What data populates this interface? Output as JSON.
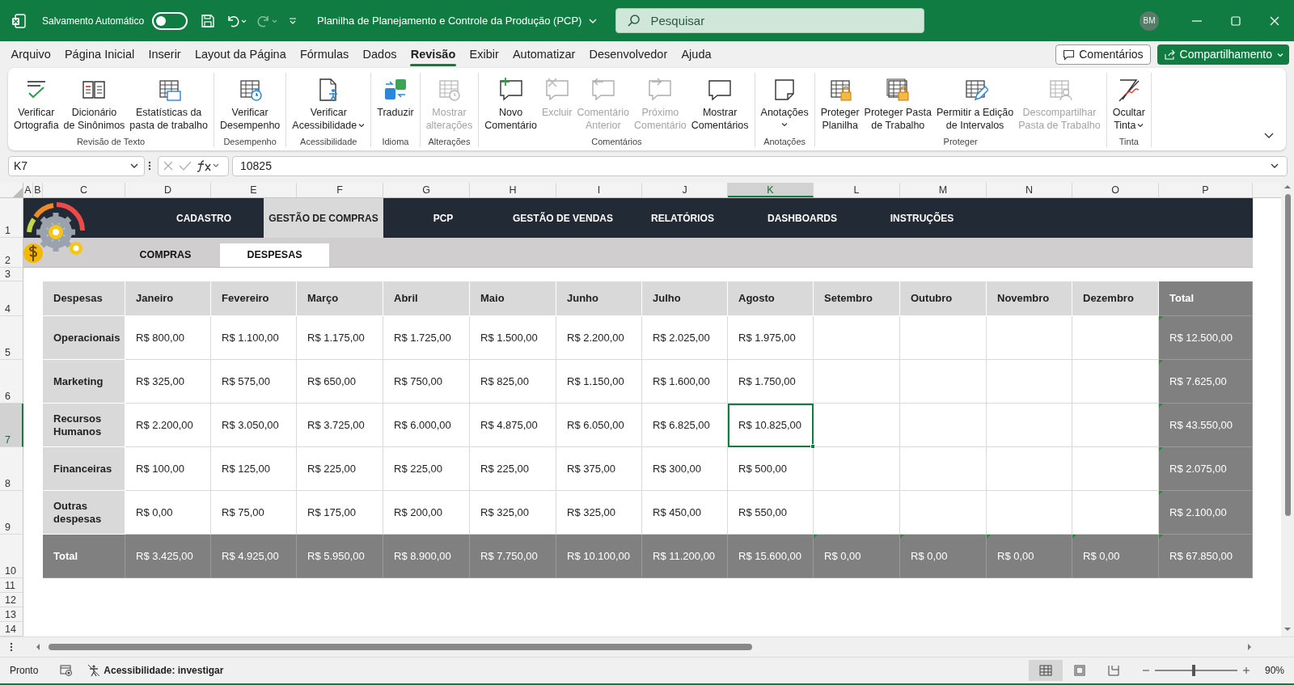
{
  "title_bar": {
    "autosave_label": "Salvamento Automático",
    "autosave_on": false,
    "document_title": "Planilha de Planejamento e Controle da Produção (PCP)",
    "search_placeholder": "Pesquisar",
    "user_initials": "BM"
  },
  "menu_tabs": [
    {
      "label": "Arquivo",
      "selected": false
    },
    {
      "label": "Página Inicial",
      "selected": false
    },
    {
      "label": "Inserir",
      "selected": false
    },
    {
      "label": "Layout da Página",
      "selected": false
    },
    {
      "label": "Fórmulas",
      "selected": false
    },
    {
      "label": "Dados",
      "selected": false
    },
    {
      "label": "Revisão",
      "selected": true
    },
    {
      "label": "Exibir",
      "selected": false
    },
    {
      "label": "Automatizar",
      "selected": false
    },
    {
      "label": "Desenvolvedor",
      "selected": false
    },
    {
      "label": "Ajuda",
      "selected": false
    }
  ],
  "comments_button": "Comentários",
  "share_button": "Compartilhamento",
  "ribbon_groups": [
    {
      "label": "Revisão de Texto",
      "buttons": [
        {
          "label": "Verificar\nOrtografia",
          "disabled": false,
          "has_menu": false
        },
        {
          "label": "Dicionário\nde Sinônimos",
          "disabled": false,
          "has_menu": false
        },
        {
          "label": "Estatísticas da\npasta de trabalho",
          "disabled": false,
          "has_menu": false
        }
      ]
    },
    {
      "label": "Desempenho",
      "buttons": [
        {
          "label": "Verificar\nDesempenho",
          "disabled": false,
          "has_menu": false
        }
      ]
    },
    {
      "label": "Acessibilidade",
      "buttons": [
        {
          "label": "Verificar\nAcessibilidade",
          "disabled": false,
          "has_menu": true
        }
      ]
    },
    {
      "label": "Idioma",
      "buttons": [
        {
          "label": "Traduzir",
          "disabled": false,
          "has_menu": false
        }
      ]
    },
    {
      "label": "Alterações",
      "buttons": [
        {
          "label": "Mostrar\nalterações",
          "disabled": true,
          "has_menu": false
        }
      ]
    },
    {
      "label": "Comentários",
      "buttons": [
        {
          "label": "Novo\nComentário",
          "disabled": false,
          "has_menu": false
        },
        {
          "label": "Excluir",
          "disabled": true,
          "has_menu": false
        },
        {
          "label": "Comentário\nAnterior",
          "disabled": true,
          "has_menu": false
        },
        {
          "label": "Próximo\nComentário",
          "disabled": true,
          "has_menu": false
        },
        {
          "label": "Mostrar\nComentários",
          "disabled": false,
          "has_menu": false
        }
      ]
    },
    {
      "label": "Anotações",
      "buttons": [
        {
          "label": "Anotações",
          "disabled": false,
          "has_menu": true
        }
      ]
    },
    {
      "label": "Proteger",
      "buttons": [
        {
          "label": "Proteger\nPlanilha",
          "disabled": false,
          "has_menu": false
        },
        {
          "label": "Proteger Pasta\nde Trabalho",
          "disabled": false,
          "has_menu": false
        },
        {
          "label": "Permitir a Edição\nde Intervalos",
          "disabled": false,
          "has_menu": false
        },
        {
          "label": "Descompartilhar\nPasta de Trabalho",
          "disabled": true,
          "has_menu": false
        }
      ]
    },
    {
      "label": "Tinta",
      "buttons": [
        {
          "label": "Ocultar\nTinta",
          "disabled": false,
          "has_menu": true
        }
      ]
    }
  ],
  "formula_bar": {
    "name_box": "K7",
    "formula": "10825"
  },
  "column_headers": [
    {
      "label": "A",
      "selected": false
    },
    {
      "label": "B",
      "selected": false
    },
    {
      "label": "C",
      "selected": false
    },
    {
      "label": "D",
      "selected": false
    },
    {
      "label": "E",
      "selected": false
    },
    {
      "label": "F",
      "selected": false
    },
    {
      "label": "G",
      "selected": false
    },
    {
      "label": "H",
      "selected": false
    },
    {
      "label": "I",
      "selected": false
    },
    {
      "label": "J",
      "selected": false
    },
    {
      "label": "K",
      "selected": true
    },
    {
      "label": "L",
      "selected": false
    },
    {
      "label": "M",
      "selected": false
    },
    {
      "label": "N",
      "selected": false
    },
    {
      "label": "O",
      "selected": false
    },
    {
      "label": "P",
      "selected": false
    }
  ],
  "row_headers": [
    {
      "label": "1",
      "selected": false
    },
    {
      "label": "2",
      "selected": false
    },
    {
      "label": "3",
      "selected": false
    },
    {
      "label": "4",
      "selected": false
    },
    {
      "label": "5",
      "selected": false
    },
    {
      "label": "6",
      "selected": false
    },
    {
      "label": "7",
      "selected": true
    },
    {
      "label": "8",
      "selected": false
    },
    {
      "label": "9",
      "selected": false
    },
    {
      "label": "10",
      "selected": false
    },
    {
      "label": "11",
      "selected": false
    },
    {
      "label": "12",
      "selected": false
    },
    {
      "label": "13",
      "selected": false
    },
    {
      "label": "14",
      "selected": false
    }
  ],
  "nav_tabs": [
    {
      "label": "CADASTRO",
      "selected": false
    },
    {
      "label": "GESTÃO DE COMPRAS",
      "selected": true
    },
    {
      "label": "PCP",
      "selected": false
    },
    {
      "label": "GESTÃO DE VENDAS",
      "selected": false
    },
    {
      "label": "RELATÓRIOS",
      "selected": false
    },
    {
      "label": "DASHBOARDS",
      "selected": false
    },
    {
      "label": "INSTRUÇÕES",
      "selected": false
    }
  ],
  "sub_tabs": [
    {
      "label": "COMPRAS",
      "selected": false
    },
    {
      "label": "DESPESAS",
      "selected": true
    }
  ],
  "table": {
    "label_heading": "Despesas",
    "columns": [
      "Janeiro",
      "Fevereiro",
      "Março",
      "Abril",
      "Maio",
      "Junho",
      "Julho",
      "Agosto",
      "Setembro",
      "Outubro",
      "Novembro",
      "Dezembro",
      "Total"
    ],
    "rows": [
      {
        "label": "Operacionais",
        "cells": [
          {
            "text": "R$ 800,00",
            "selected": false
          },
          {
            "text": "R$ 1.100,00",
            "selected": false
          },
          {
            "text": "R$ 1.175,00",
            "selected": false
          },
          {
            "text": "R$ 1.725,00",
            "selected": false
          },
          {
            "text": "R$ 1.500,00",
            "selected": false
          },
          {
            "text": "R$ 2.200,00",
            "selected": false
          },
          {
            "text": "R$ 2.025,00",
            "selected": false
          },
          {
            "text": "R$ 1.975,00",
            "selected": false
          }
        ],
        "total": "R$ 12.500,00",
        "total_flagged": true
      },
      {
        "label": "Marketing",
        "cells": [
          {
            "text": "R$ 325,00",
            "selected": false
          },
          {
            "text": "R$ 575,00",
            "selected": false
          },
          {
            "text": "R$ 650,00",
            "selected": false
          },
          {
            "text": "R$ 750,00",
            "selected": false
          },
          {
            "text": "R$ 825,00",
            "selected": false
          },
          {
            "text": "R$ 1.150,00",
            "selected": false
          },
          {
            "text": "R$ 1.600,00",
            "selected": false
          },
          {
            "text": "R$ 1.750,00",
            "selected": false
          }
        ],
        "total": "R$ 7.625,00",
        "total_flagged": true
      },
      {
        "label": "Recursos Humanos",
        "cells": [
          {
            "text": "R$ 2.200,00",
            "selected": false
          },
          {
            "text": "R$ 3.050,00",
            "selected": false
          },
          {
            "text": "R$ 3.725,00",
            "selected": false
          },
          {
            "text": "R$ 6.000,00",
            "selected": false
          },
          {
            "text": "R$ 4.875,00",
            "selected": false
          },
          {
            "text": "R$ 6.050,00",
            "selected": false
          },
          {
            "text": "R$ 6.825,00",
            "selected": false
          },
          {
            "text": "R$ 10.825,00",
            "selected": true
          }
        ],
        "total": "R$ 43.550,00",
        "total_flagged": true
      },
      {
        "label": "Financeiras",
        "cells": [
          {
            "text": "R$ 100,00",
            "selected": false
          },
          {
            "text": "R$ 125,00",
            "selected": false
          },
          {
            "text": "R$ 225,00",
            "selected": false
          },
          {
            "text": "R$ 225,00",
            "selected": false
          },
          {
            "text": "R$ 225,00",
            "selected": false
          },
          {
            "text": "R$ 375,00",
            "selected": false
          },
          {
            "text": "R$ 300,00",
            "selected": false
          },
          {
            "text": "R$ 500,00",
            "selected": false
          }
        ],
        "total": "R$ 2.075,00",
        "total_flagged": true
      },
      {
        "label": "Outras despesas",
        "cells": [
          {
            "text": "R$ 0,00",
            "selected": false
          },
          {
            "text": "R$ 75,00",
            "selected": false
          },
          {
            "text": "R$ 175,00",
            "selected": false
          },
          {
            "text": "R$ 200,00",
            "selected": false
          },
          {
            "text": "R$ 325,00",
            "selected": false
          },
          {
            "text": "R$ 325,00",
            "selected": false
          },
          {
            "text": "R$ 450,00",
            "selected": false
          },
          {
            "text": "R$ 550,00",
            "selected": false
          }
        ],
        "total": "R$ 2.100,00",
        "total_flagged": true
      }
    ],
    "total_row": {
      "label": "Total",
      "cells": [
        {
          "text": "R$ 3.425,00",
          "flagged": false
        },
        {
          "text": "R$ 4.925,00",
          "flagged": false
        },
        {
          "text": "R$ 5.950,00",
          "flagged": false
        },
        {
          "text": "R$ 8.900,00",
          "flagged": false
        },
        {
          "text": "R$ 7.750,00",
          "flagged": false
        },
        {
          "text": "R$ 10.100,00",
          "flagged": false
        },
        {
          "text": "R$ 11.200,00",
          "flagged": false
        },
        {
          "text": "R$ 15.600,00",
          "flagged": false
        },
        {
          "text": "R$ 0,00",
          "flagged": true
        },
        {
          "text": "R$ 0,00",
          "flagged": true
        },
        {
          "text": "R$ 0,00",
          "flagged": true
        },
        {
          "text": "R$ 0,00",
          "flagged": true
        }
      ],
      "total": "R$ 67.850,00",
      "total_flagged": true
    }
  },
  "status_bar": {
    "status": "Pronto",
    "accessibility": "Acessibilidade: investigar",
    "views": [
      {
        "selected": true
      },
      {
        "selected": false
      },
      {
        "selected": false
      }
    ],
    "zoom": {
      "level": 0.47,
      "label": "90%"
    }
  }
}
